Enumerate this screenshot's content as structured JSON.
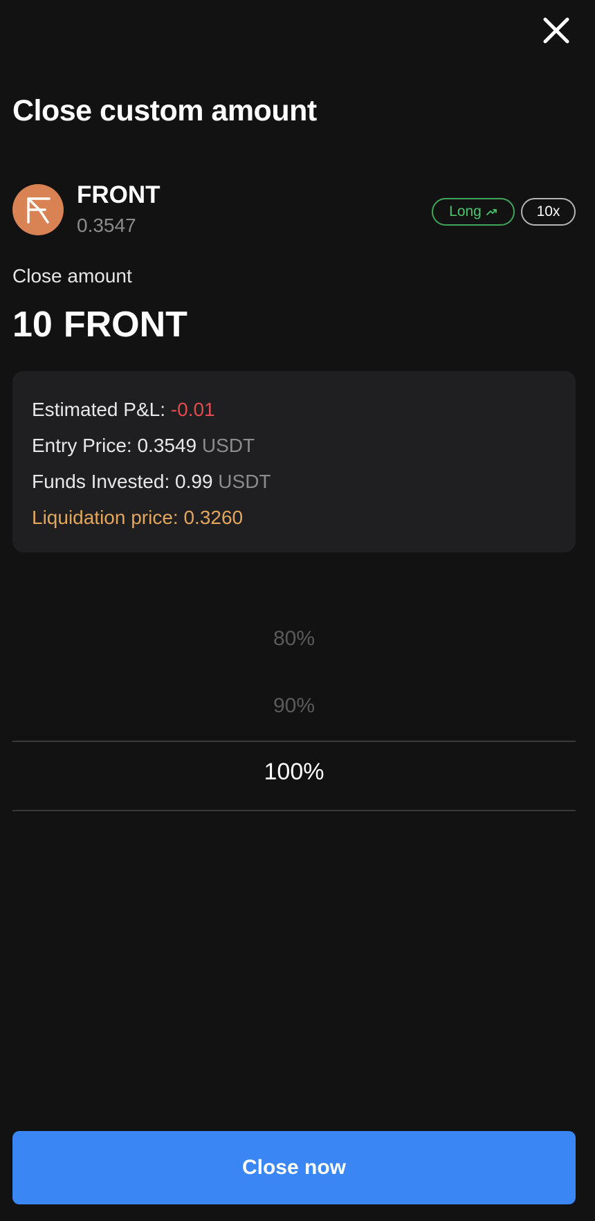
{
  "header": {
    "close_icon": "close-icon"
  },
  "title": "Close custom amount",
  "asset": {
    "symbol": "FRONT",
    "price": "0.3547",
    "logo_icon": "front-token-logo",
    "logo_color": "#d98354",
    "side_label": "Long",
    "side_icon": "trend-up-icon",
    "side_color": "#4cc46b",
    "leverage_label": "10x"
  },
  "close_amount": {
    "label": "Close amount",
    "amount": "10",
    "unit": "FRONT"
  },
  "details": {
    "pnl_label": "Estimated P&L:",
    "pnl_value": "-0.01",
    "pnl_color": "#e24c4c",
    "entry_label": "Entry Price:",
    "entry_value": "0.3549",
    "entry_unit": "USDT",
    "funds_label": "Funds Invested:",
    "funds_value": "0.99",
    "funds_unit": "USDT",
    "liq_label": "Liquidation price:",
    "liq_value": "0.3260",
    "liq_color": "#e3a65d"
  },
  "percent_picker": {
    "options": [
      "80%",
      "90%",
      "100%"
    ],
    "selected": "100%"
  },
  "action": {
    "close_now_label": "Close now",
    "color": "#3b86f5"
  }
}
